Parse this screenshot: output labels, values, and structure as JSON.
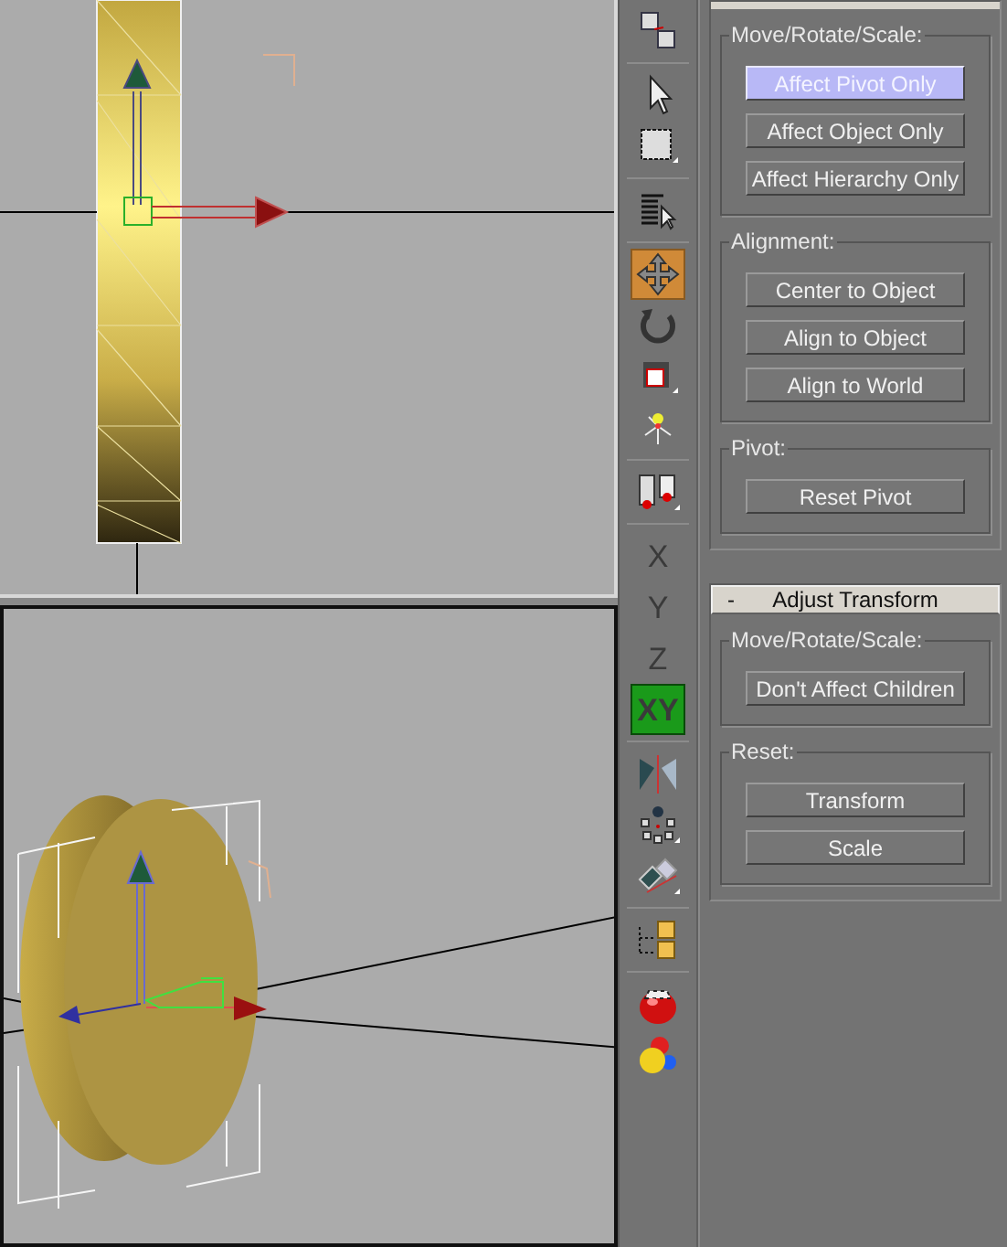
{
  "viewports": [
    {
      "kind": "side",
      "active": false
    },
    {
      "kind": "perspective",
      "active": true
    }
  ],
  "toolbar": [
    {
      "kind": "link",
      "selected": false
    },
    {
      "kind": "separator"
    },
    {
      "kind": "select",
      "selected": false
    },
    {
      "kind": "region",
      "selected": false
    },
    {
      "kind": "separator"
    },
    {
      "kind": "select-by-name",
      "selected": false
    },
    {
      "kind": "separator"
    },
    {
      "kind": "move",
      "selected": true
    },
    {
      "kind": "rotate",
      "selected": false
    },
    {
      "kind": "scale",
      "selected": false
    },
    {
      "kind": "pivot",
      "selected": false
    },
    {
      "kind": "separator"
    },
    {
      "kind": "constraint",
      "selected": false
    },
    {
      "kind": "separator"
    },
    {
      "kind": "axis",
      "label": "X",
      "selected": false
    },
    {
      "kind": "axis",
      "label": "Y",
      "selected": false
    },
    {
      "kind": "axis",
      "label": "Z",
      "selected": false
    },
    {
      "kind": "axis",
      "label": "XY",
      "selected": true
    },
    {
      "kind": "separator"
    },
    {
      "kind": "mirror",
      "selected": false
    },
    {
      "kind": "array",
      "selected": false
    },
    {
      "kind": "align",
      "selected": false
    },
    {
      "kind": "separator"
    },
    {
      "kind": "layer",
      "selected": false
    },
    {
      "kind": "separator"
    },
    {
      "kind": "render",
      "selected": false
    },
    {
      "kind": "material",
      "selected": false
    }
  ],
  "rollouts": [
    {
      "groups": [
        {
          "label": "Move/Rotate/Scale:",
          "buttons": [
            {
              "label": "Affect Pivot Only",
              "selected": true
            },
            {
              "label": "Affect Object Only",
              "selected": false
            },
            {
              "label": "Affect Hierarchy Only",
              "selected": false
            }
          ]
        },
        {
          "label": "Alignment:",
          "buttons": [
            {
              "label": "Center to Object",
              "selected": false
            },
            {
              "label": "Align to Object",
              "selected": false
            },
            {
              "label": "Align to World",
              "selected": false
            }
          ]
        },
        {
          "label": "Pivot:",
          "buttons": [
            {
              "label": "Reset Pivot",
              "selected": false
            }
          ]
        }
      ]
    },
    {
      "title": "Adjust Transform",
      "sign": "-",
      "groups": [
        {
          "label": "Move/Rotate/Scale:",
          "buttons": [
            {
              "label": "Don't Affect Children",
              "selected": false
            }
          ]
        },
        {
          "label": "Reset:",
          "buttons": [
            {
              "label": "Transform",
              "selected": false
            },
            {
              "label": "Scale",
              "selected": false
            }
          ]
        }
      ]
    }
  ]
}
